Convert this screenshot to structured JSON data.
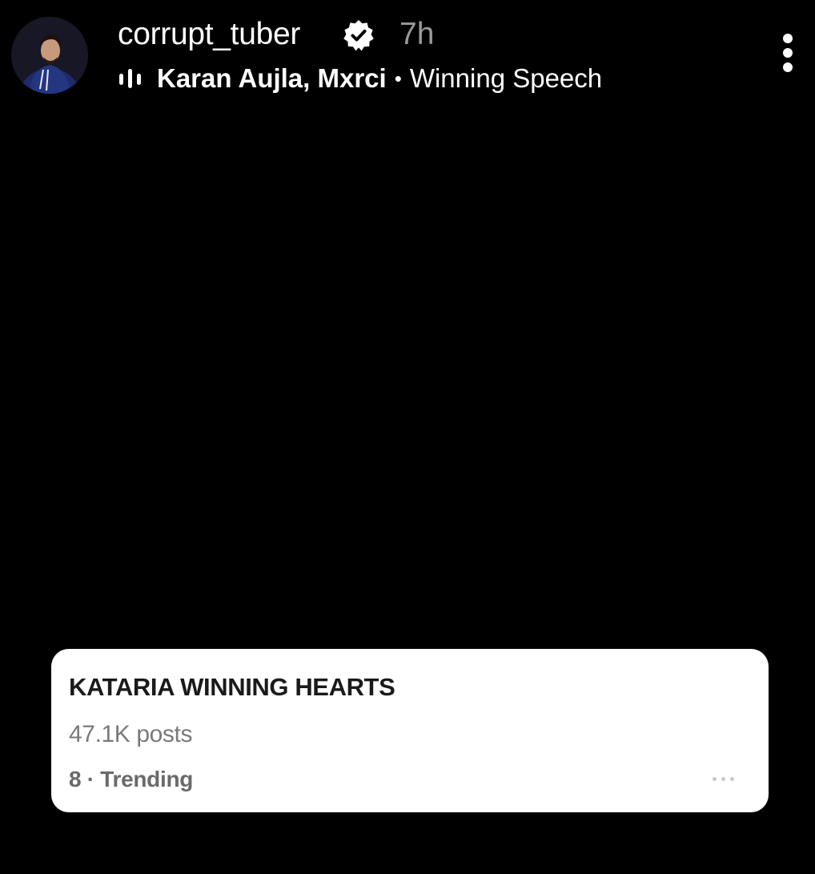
{
  "header": {
    "username": "corrupt_tuber",
    "verified": true,
    "time_ago": "7h",
    "music": {
      "icon": "audio-bars-icon",
      "artists": "Karan Aujla, Mxrci",
      "separator": "•",
      "song": "Winning Speech"
    },
    "more_icon": "vertical-ellipsis-icon"
  },
  "trend_card": {
    "title": "KATARIA WINNING HEARTS",
    "posts": "47.1K posts",
    "rank_label": "8 · Trending",
    "more_icon": "horizontal-ellipsis-icon"
  },
  "colors": {
    "background": "#000000",
    "text_primary": "#ffffff",
    "text_muted": "#9a9a9a",
    "card_background": "#ffffff",
    "card_title": "#1a1a1a",
    "card_meta": "#7a7a7a"
  }
}
